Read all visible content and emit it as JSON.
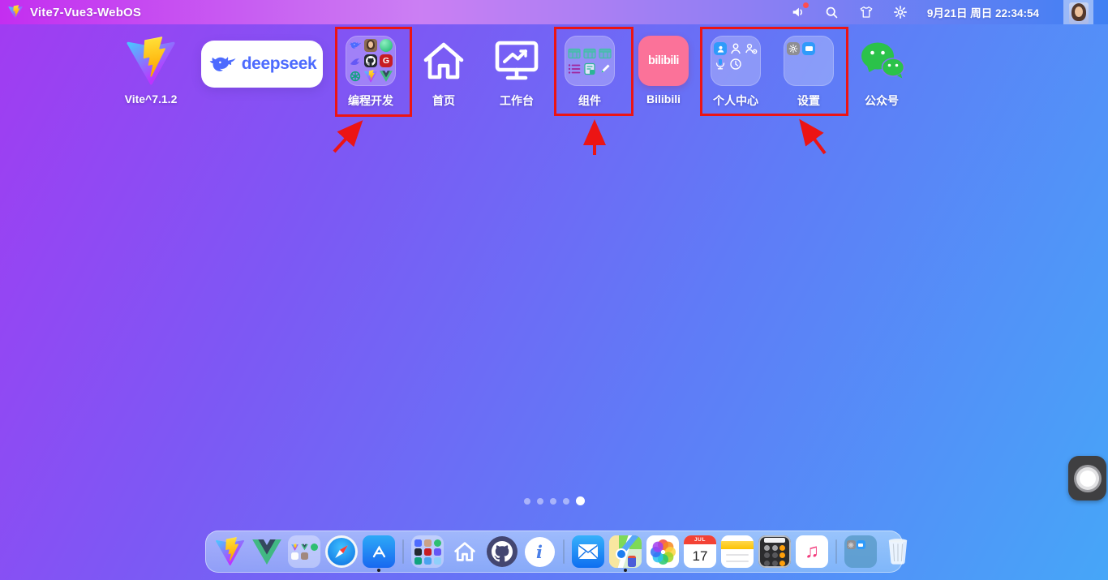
{
  "menubar": {
    "title": "Vite7-Vue3-WebOS",
    "datetime": "9月21日 周日 22:34:54",
    "volume_alert": true,
    "icons": [
      "volume-icon",
      "search-icon",
      "theme-shirt-icon",
      "settings-gear-icon",
      "user-avatar"
    ]
  },
  "apps": {
    "vite": {
      "label": "Vite^7.1.2"
    },
    "deepseek": {
      "brand": "deepseek"
    },
    "dev": {
      "label": "编程开发",
      "mini_icons": [
        "deepseek-whale",
        "avatar-photo",
        "green-orb",
        "bird",
        "github",
        "gitee",
        "chatgpt",
        "vite",
        "vue"
      ]
    },
    "home": {
      "label": "首页"
    },
    "work": {
      "label": "工作台"
    },
    "comp": {
      "label": "组件",
      "mini_icons": [
        "table",
        "table",
        "table",
        "list",
        "form",
        "pencil"
      ]
    },
    "bili": {
      "label": "Bilibili",
      "brand": "bilibili"
    },
    "profile": {
      "label": "个人中心",
      "mini_icons": [
        "user-filled",
        "user-outline",
        "team",
        "microphone",
        "clock"
      ]
    },
    "settings": {
      "label": "设置",
      "mini_icons": [
        "gear",
        "panel"
      ]
    },
    "wechat": {
      "label": "公众号"
    }
  },
  "glyphs": {
    "gitee": "G",
    "appstore": "A",
    "info": "i"
  },
  "annotations": {
    "color": "#ec1414",
    "boxes": [
      "dev-folder",
      "components-folder",
      "profile-and-settings-folders"
    ],
    "arrow_count": 3
  },
  "pager": {
    "total": 5,
    "active_index": 4
  },
  "dock": {
    "calendar": {
      "month": "JUL",
      "day": "17"
    },
    "running": [
      "app-store",
      "maps"
    ],
    "items": [
      "vite",
      "vue",
      "apps-folder",
      "safari",
      "app-store",
      "divider",
      "dev-folder",
      "home",
      "github",
      "info",
      "divider",
      "mail",
      "maps",
      "photos",
      "calendar",
      "notes",
      "calculator",
      "music",
      "divider",
      "settings-folder",
      "trash"
    ]
  },
  "assistive_button": true,
  "colors": {
    "annotation": "#ec1414",
    "bilibili": "#fb7299",
    "wechat": "#2bc24a",
    "deepseek": "#4d6bfe",
    "wallpaper_top_left": "#a23bf2",
    "wallpaper_bottom_right": "#46a6f8",
    "menubar_left": "#c42ef0",
    "menubar_right": "#3f80f3"
  }
}
